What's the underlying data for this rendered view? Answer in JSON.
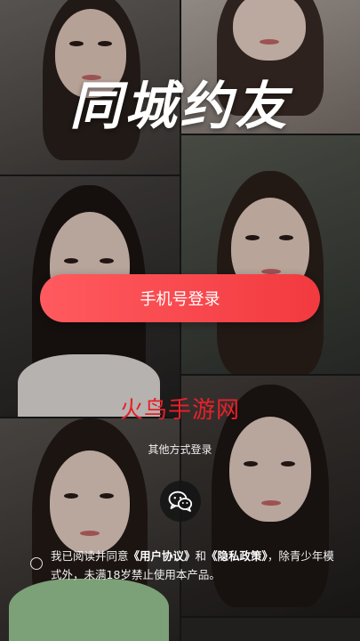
{
  "headline": "同城约友",
  "login": {
    "phone_button_label": "手机号登录",
    "other_methods_label": "其他方式登录",
    "wechat_icon": "wechat-icon"
  },
  "watermark": "火鸟手游网",
  "agreement": {
    "prefix": "我已阅读并同意",
    "user_agreement": "《用户协议》",
    "and": "和",
    "privacy_policy": "《隐私政策》",
    "suffix": "，除青少年模式外，未满18岁禁止使用本产品。"
  },
  "colors": {
    "accent": "#f23a3f",
    "watermark": "#e8202a"
  }
}
